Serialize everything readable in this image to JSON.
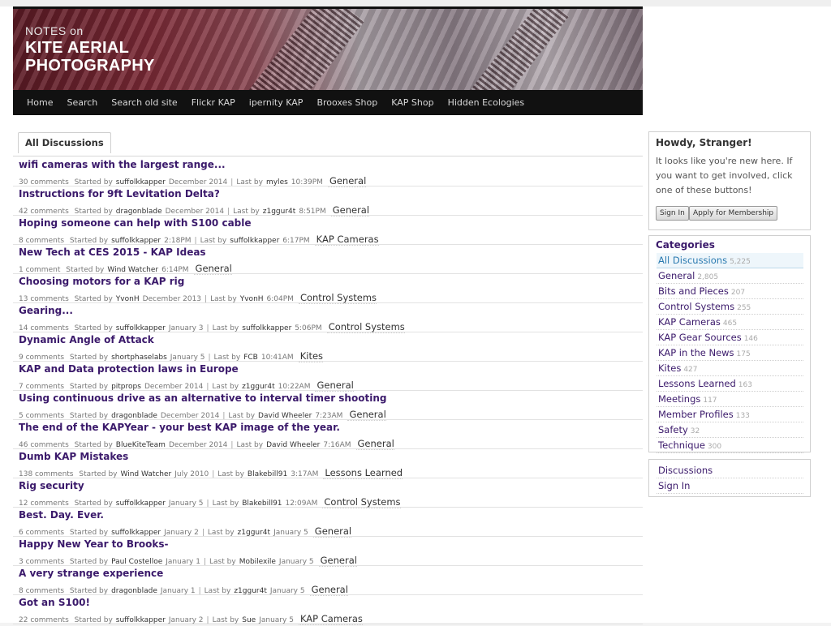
{
  "banner": {
    "line1": "NOTES on",
    "line2": "KITE AERIAL",
    "line3": "PHOTOGRAPHY"
  },
  "nav": [
    "Home",
    "Search",
    "Search old site",
    "Flickr KAP",
    "ipernity KAP",
    "Brooxes Shop",
    "KAP Shop",
    "Hidden Ecologies"
  ],
  "tab": "All Discussions",
  "discussions": [
    {
      "title": "wifi cameras with the largest range...",
      "comments": "30 comments",
      "started_by": "suffolkkapper",
      "started": "December 2014",
      "last_by": "myles",
      "last": "10:39PM",
      "category": "General"
    },
    {
      "title": "Instructions for 9ft Levitation Delta?",
      "comments": "42 comments",
      "started_by": "dragonblade",
      "started": "December 2014",
      "last_by": "z1ggur4t",
      "last": "8:51PM",
      "category": "General"
    },
    {
      "title": "Hoping someone can help with S100 cable",
      "comments": "8 comments",
      "started_by": "suffolkkapper",
      "started": "2:18PM",
      "last_by": "suffolkkapper",
      "last": "6:17PM",
      "category": "KAP Cameras"
    },
    {
      "title": "New Tech at CES 2015 - KAP Ideas",
      "comments": "1 comment",
      "started_by": "Wind Watcher",
      "started": "6:14PM",
      "last_by": "",
      "last": "",
      "category": "General"
    },
    {
      "title": "Choosing motors for a KAP rig",
      "comments": "13 comments",
      "started_by": "YvonH",
      "started": "December 2013",
      "last_by": "YvonH",
      "last": "6:04PM",
      "category": "Control Systems"
    },
    {
      "title": "Gearing...",
      "comments": "14 comments",
      "started_by": "suffolkkapper",
      "started": "January 3",
      "last_by": "suffolkkapper",
      "last": "5:06PM",
      "category": "Control Systems"
    },
    {
      "title": "Dynamic Angle of Attack",
      "comments": "9 comments",
      "started_by": "shortphaselabs",
      "started": "January 5",
      "last_by": "FCB",
      "last": "10:41AM",
      "category": "Kites"
    },
    {
      "title": "KAP and Data protection laws in Europe",
      "comments": "7 comments",
      "started_by": "pitprops",
      "started": "December 2014",
      "last_by": "z1ggur4t",
      "last": "10:22AM",
      "category": "General"
    },
    {
      "title": "Using continuous drive as an alternative to interval timer shooting",
      "comments": "5 comments",
      "started_by": "dragonblade",
      "started": "December 2014",
      "last_by": "David Wheeler",
      "last": "7:23AM",
      "category": "General"
    },
    {
      "title": "The end of the KAPYear - your best KAP image of the year.",
      "comments": "46 comments",
      "started_by": "BlueKiteTeam",
      "started": "December 2014",
      "last_by": "David Wheeler",
      "last": "7:16AM",
      "category": "General"
    },
    {
      "title": "Dumb KAP Mistakes",
      "comments": "138 comments",
      "started_by": "Wind Watcher",
      "started": "July 2010",
      "last_by": "Blakebill91",
      "last": "3:17AM",
      "category": "Lessons Learned"
    },
    {
      "title": "Rig security",
      "comments": "12 comments",
      "started_by": "suffolkkapper",
      "started": "January 5",
      "last_by": "Blakebill91",
      "last": "12:09AM",
      "category": "Control Systems"
    },
    {
      "title": "Best. Day. Ever.",
      "comments": "6 comments",
      "started_by": "suffolkkapper",
      "started": "January 2",
      "last_by": "z1ggur4t",
      "last": "January 5",
      "category": "General"
    },
    {
      "title": "Happy New Year to Brooks-",
      "comments": "3 comments",
      "started_by": "Paul Costelloe",
      "started": "January 1",
      "last_by": "Mobilexile",
      "last": "January 5",
      "category": "General"
    },
    {
      "title": "A very strange experience",
      "comments": "8 comments",
      "started_by": "dragonblade",
      "started": "January 1",
      "last_by": "z1ggur4t",
      "last": "January 5",
      "category": "General"
    },
    {
      "title": "Got an S100!",
      "comments": "22 comments",
      "started_by": "suffolkkapper",
      "started": "January 2",
      "last_by": "Sue",
      "last": "January 5",
      "category": "KAP Cameras"
    }
  ],
  "labels": {
    "started_by": "Started by",
    "last_by": "Last by",
    "sep": "|"
  },
  "howdy": {
    "heading": "Howdy, Stranger!",
    "text": "It looks like you're new here. If you want to get involved, click one of these buttons!",
    "sign_in": "Sign In",
    "apply": "Apply for Membership"
  },
  "categories": {
    "heading": "Categories",
    "items": [
      {
        "name": "All Discussions",
        "count": "5,225",
        "active": true
      },
      {
        "name": "General",
        "count": "2,805"
      },
      {
        "name": "Bits and Pieces",
        "count": "207"
      },
      {
        "name": "Control Systems",
        "count": "255"
      },
      {
        "name": "KAP Cameras",
        "count": "465"
      },
      {
        "name": "KAP Gear Sources",
        "count": "146"
      },
      {
        "name": "KAP in the News",
        "count": "175"
      },
      {
        "name": "Kites",
        "count": "427"
      },
      {
        "name": "Lessons Learned",
        "count": "163"
      },
      {
        "name": "Meetings",
        "count": "117"
      },
      {
        "name": "Member Profiles",
        "count": "133"
      },
      {
        "name": "Safety",
        "count": "32"
      },
      {
        "name": "Technique",
        "count": "300"
      }
    ]
  },
  "bottom_links": [
    "Discussions",
    "Sign In"
  ]
}
